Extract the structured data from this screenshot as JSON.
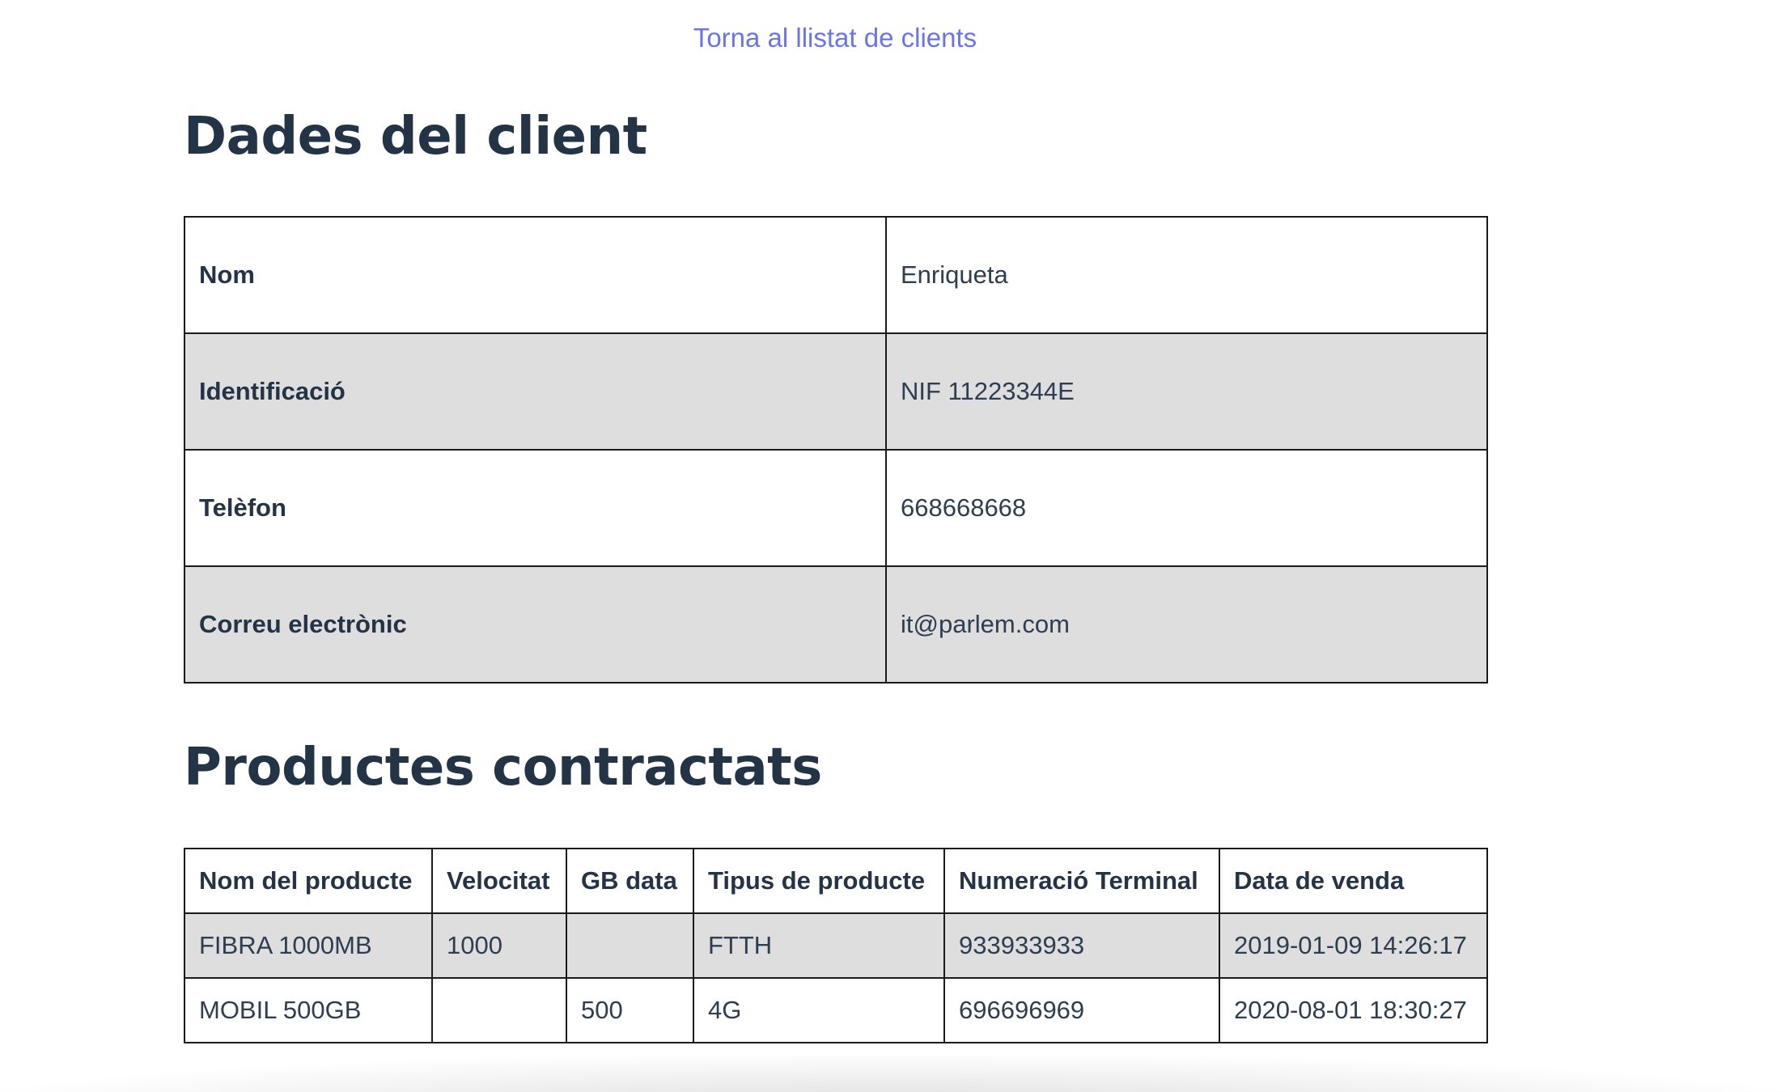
{
  "nav": {
    "back_link": "Torna al llistat de clients"
  },
  "client_section": {
    "title": "Dades del client",
    "rows": [
      {
        "label": "Nom",
        "value": "Enriqueta"
      },
      {
        "label": "Identificació",
        "value": "NIF 11223344E"
      },
      {
        "label": "Telèfon",
        "value": "668668668"
      },
      {
        "label": "Correu electrònic",
        "value": "it@parlem.com"
      }
    ]
  },
  "products_section": {
    "title": "Productes contractats",
    "headers": [
      "Nom del producte",
      "Velocitat",
      "GB data",
      "Tipus de producte",
      "Numeració Terminal",
      "Data de venda"
    ],
    "rows": [
      [
        "FIBRA 1000MB",
        "1000",
        "",
        "FTTH",
        "933933933",
        "2019-01-09 14:26:17"
      ],
      [
        "MOBIL 500GB",
        "",
        "500",
        "4G",
        "696696969",
        "2020-08-01 18:30:27"
      ]
    ]
  },
  "colors": {
    "link": "#6b74e6",
    "heading": "#243447",
    "row_shade": "#dedede",
    "border": "#1a1a1a"
  }
}
